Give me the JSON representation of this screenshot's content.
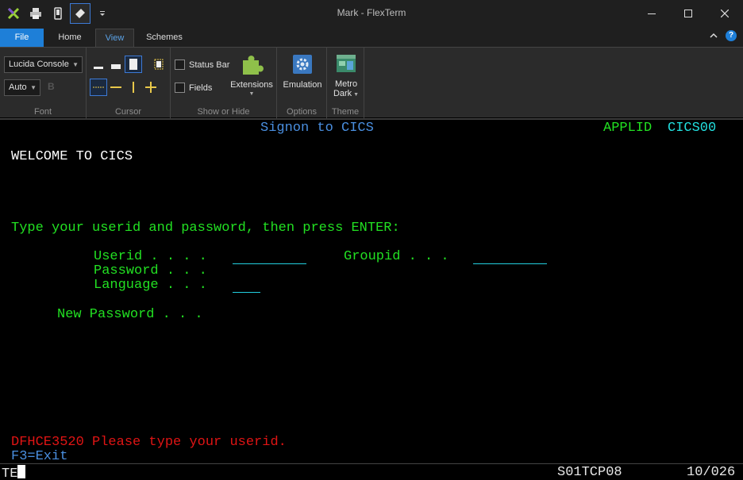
{
  "window": {
    "title": "Mark - FlexTerm"
  },
  "quick_access": {
    "icons": [
      "flexterm-logo-icon",
      "print-icon",
      "device-icon",
      "eraser-icon",
      "customize-dropdown-icon"
    ]
  },
  "tabs": [
    {
      "label": "File"
    },
    {
      "label": "Home"
    },
    {
      "label": "View"
    },
    {
      "label": "Schemes"
    }
  ],
  "ribbon": {
    "font": {
      "label": "Font",
      "font_name": "Lucida Console",
      "font_size": "Auto",
      "bold_glyph": "B"
    },
    "cursor": {
      "label": "Cursor"
    },
    "show_hide": {
      "label": "Show or Hide",
      "status_bar": "Status Bar",
      "fields": "Fields",
      "extensions": "Extensions"
    },
    "options": {
      "label": "Options",
      "emulation": "Emulation"
    },
    "theme": {
      "label": "Theme",
      "theme_line1": "Metro",
      "theme_line2": "Dark"
    }
  },
  "terminal": {
    "header_title": "Signon to CICS",
    "applid_label": "APPLID",
    "applid_value": "CICS00",
    "welcome": "WELCOME TO CICS",
    "instruction": "Type your userid and password, then press ENTER:",
    "userid_label": "Userid . . . .",
    "groupid_label": "Groupid . . .",
    "password_label": "Password . . .",
    "language_label": "Language . . .",
    "new_password_label": "New Password . . .",
    "message": "DFHCE3520 Please type your userid.",
    "pf_keys": "F3=Exit"
  },
  "status_line": {
    "left": "TE",
    "session": "S01TCP08",
    "cursor_pos": "10/026"
  },
  "colors": {
    "terminal_green": "#22e022",
    "terminal_blue": "#4a8fe0",
    "terminal_cyan": "#22e0e0",
    "terminal_red": "#e01414",
    "accent": "#1e7fd8"
  }
}
